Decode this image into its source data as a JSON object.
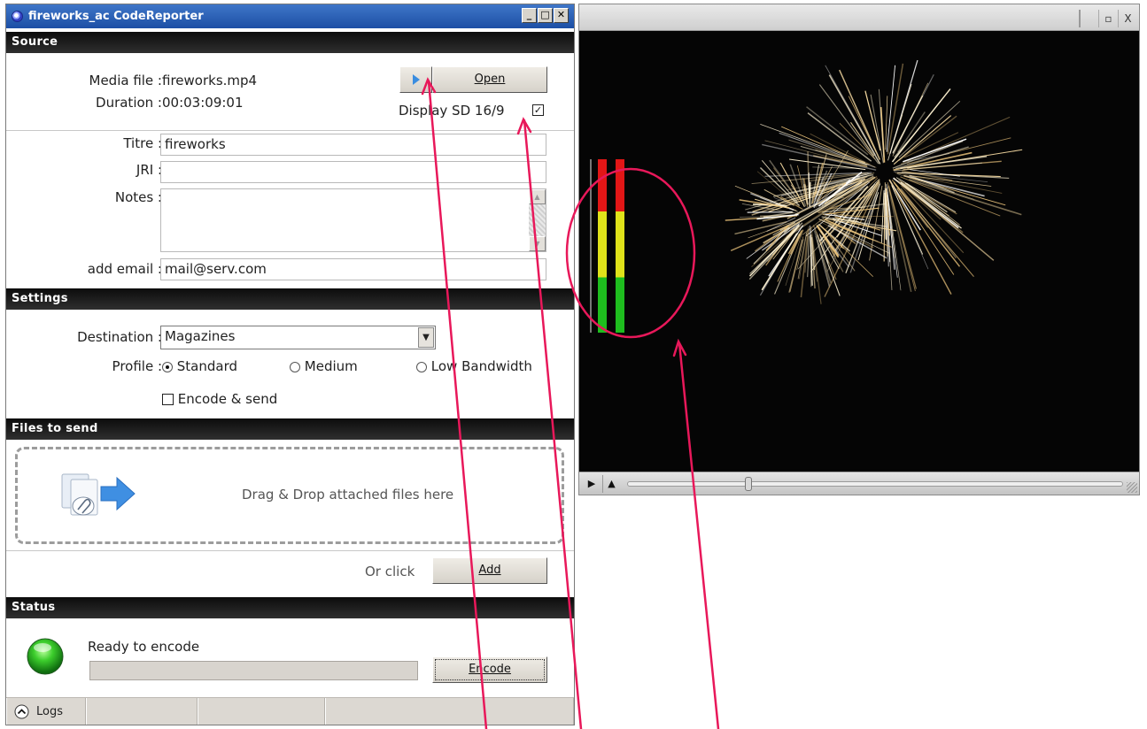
{
  "window": {
    "title": "fireworks_ac CodeReporter"
  },
  "source": {
    "header": "Source",
    "media_file_label": "Media file :",
    "media_file_value": "fireworks.mp4",
    "duration_label": "Duration :",
    "duration_value": "00:03:09:01",
    "open_button": "Open",
    "display_sd_label": "Display SD 16/9",
    "display_sd_checked": true,
    "titre_label": "Titre :",
    "titre_value": "fireworks",
    "jri_label": "JRI :",
    "jri_value": "",
    "notes_label": "Notes :",
    "notes_value": "",
    "email_label": "add email :",
    "email_value": "mail@serv.com"
  },
  "settings": {
    "header": "Settings",
    "destination_label": "Destination :",
    "destination_value": "Magazines",
    "profile_label": "Profile :",
    "profiles": [
      "Standard",
      "Medium",
      "Low Bandwidth"
    ],
    "selected_profile": "Standard",
    "encode_send_label": "Encode & send",
    "encode_send_checked": false
  },
  "files": {
    "header": "Files to send",
    "drop_text": "Drag & Drop attached files here",
    "or_click": "Or click",
    "add_button": "Add"
  },
  "status": {
    "header": "Status",
    "message": "Ready to encode",
    "encode_button": "Encode",
    "indicator_color": "#22b022",
    "progress": 0
  },
  "statusbar": {
    "logs_label": "Logs"
  },
  "player": {
    "restore_glyph": "▫",
    "close_glyph": "X",
    "play_glyph": "▶",
    "eject_glyph": "▲",
    "seek_position": 0.24
  },
  "annotation_color": "#e8185a"
}
